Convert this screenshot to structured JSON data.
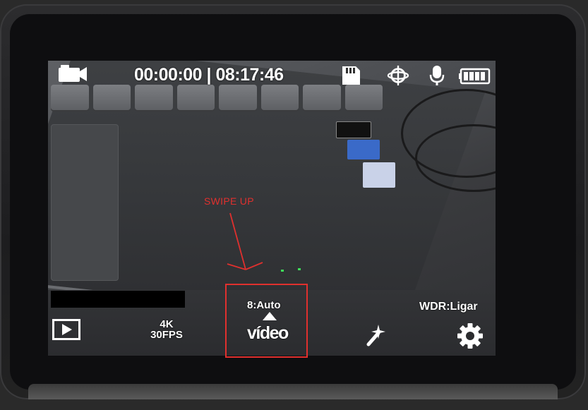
{
  "status_bar": {
    "elapsed_time": "00:00:00",
    "separator": "|",
    "clock_time": "08:17:46",
    "icons": [
      "video-camera-icon",
      "sd-card-icon",
      "gyro-stabilizer-icon",
      "microphone-icon",
      "battery-icon"
    ]
  },
  "settings": {
    "resolution_line1": "4K",
    "resolution_line2": "30FPS",
    "aux_label": "8:Auto",
    "mode_label": "vídeo",
    "wdr_label": "WDR:Ligar"
  },
  "bottom_icons": [
    "play-icon",
    "magic-wand-icon",
    "gear-icon",
    "up-arrow-icon"
  ],
  "annotation": {
    "text": "SWIPE UP",
    "color": "#e0302e"
  },
  "colors": {
    "osd_text": "#ffffff",
    "annotation": "#e0302e",
    "battery_fill": "#ffffff"
  }
}
